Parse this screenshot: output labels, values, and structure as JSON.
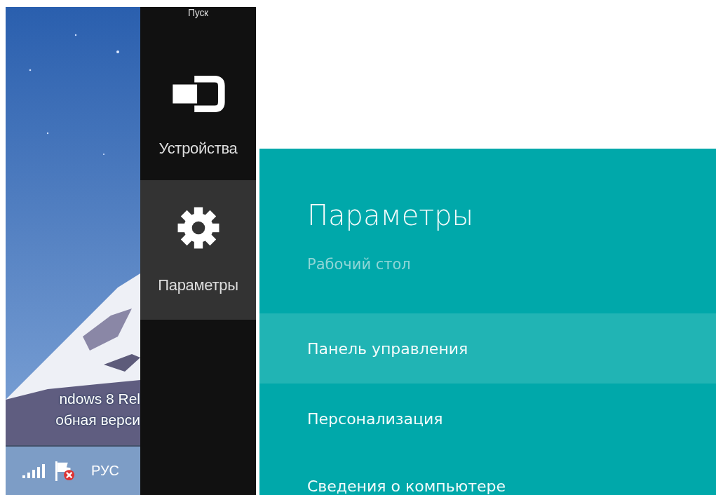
{
  "desktop": {
    "picture": {
      "kind": "picture"
    },
    "overlay_lines": [
      "ndows 8 Rel",
      "обная верси"
    ],
    "taskbar": {
      "language": "РУС"
    }
  },
  "charms": [
    {
      "label": "Пуск",
      "kind": "start",
      "selected": false
    },
    {
      "label": "Устройства",
      "kind": "devices",
      "selected": false
    },
    {
      "label": "Параметры",
      "kind": "settings",
      "selected": true
    }
  ],
  "settings": {
    "title": "Параметры",
    "subtitle": "Рабочий стол",
    "items": [
      {
        "label": "Панель управления",
        "selected": true
      },
      {
        "label": "Персонализация",
        "selected": false
      },
      {
        "label": "Сведения о компьютере",
        "selected": false
      }
    ]
  }
}
